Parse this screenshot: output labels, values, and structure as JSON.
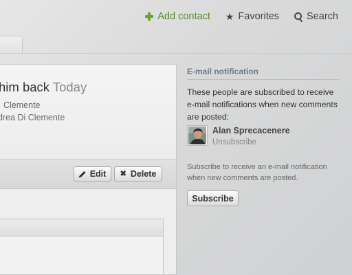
{
  "topnav": {
    "add_contact": "Add contact",
    "favorites": "Favorites",
    "search": "Search"
  },
  "panel": {
    "title": "him back",
    "title_date": "Today",
    "meta_line1": "Clemente",
    "meta_line2": "drea Di Clemente",
    "edit_label": "Edit",
    "delete_label": "Delete"
  },
  "sidebar": {
    "heading": "E-mail notification",
    "description": "These people are subscribed to receive e-mail notifications when new comments are posted:",
    "subscriber_name": "Alan Sprecacenere",
    "unsubscribe_label": "Unsubscribe",
    "subscribe_description": "Subscribe to receive an e-mail notification when new comments are posted.",
    "subscribe_label": "Subscribe"
  },
  "colors": {
    "accent_green": "#5a8b2c",
    "heading_blue_gray": "#6c7a89"
  },
  "icons": [
    "plus-icon",
    "star-icon",
    "search-icon",
    "pencil-icon",
    "x-icon"
  ]
}
